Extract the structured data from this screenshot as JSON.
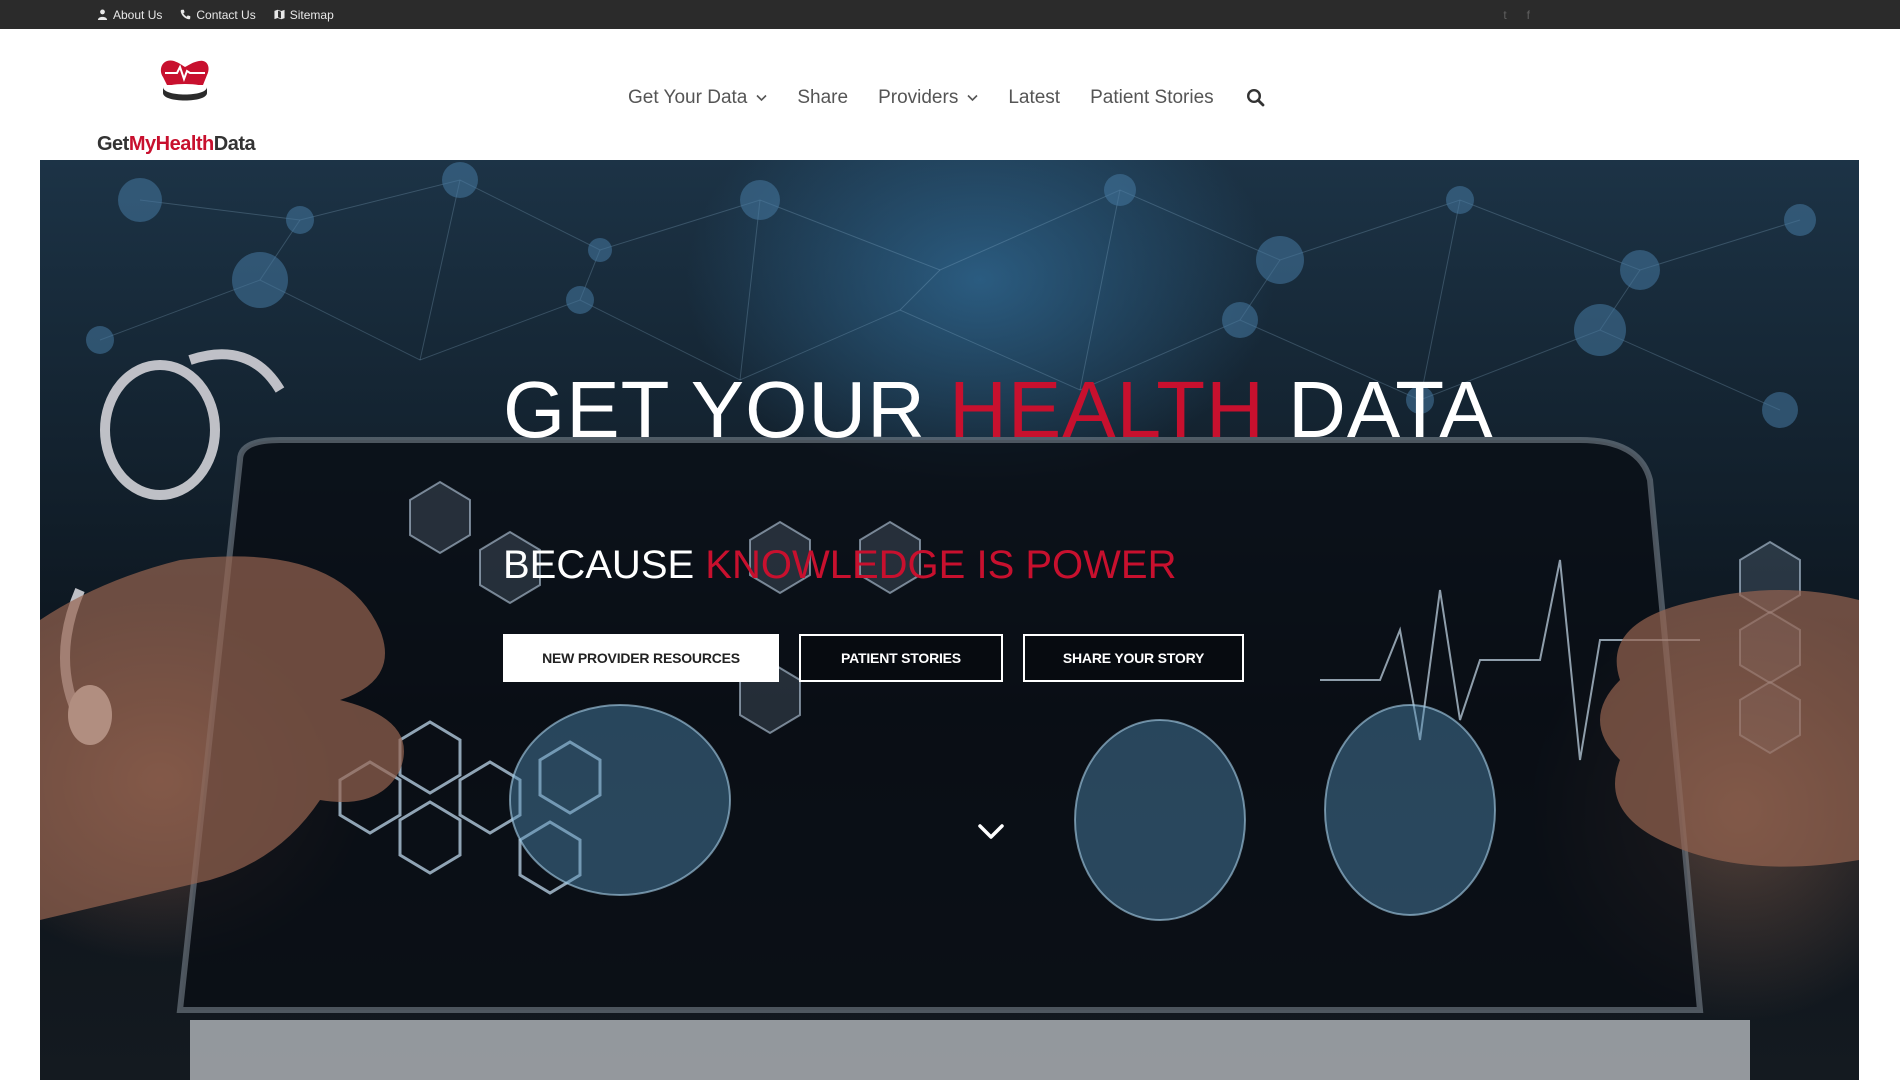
{
  "topbar": {
    "links": [
      {
        "label": "About Us",
        "icon": "user-icon"
      },
      {
        "label": "Contact Us",
        "icon": "phone-icon"
      },
      {
        "label": "Sitemap",
        "icon": "map-icon"
      }
    ],
    "social": [
      {
        "icon": "twitter-icon",
        "glyph": "t"
      },
      {
        "icon": "facebook-icon",
        "glyph": "f"
      }
    ]
  },
  "header": {
    "logo": {
      "text_dark_1": "Get",
      "text_red": "MyHealth",
      "text_dark_2": "Data"
    },
    "nav": [
      {
        "label": "Get Your Data",
        "has_dropdown": true
      },
      {
        "label": "Share",
        "has_dropdown": false
      },
      {
        "label": "Providers",
        "has_dropdown": true
      },
      {
        "label": "Latest",
        "has_dropdown": false
      },
      {
        "label": "Patient Stories",
        "has_dropdown": false
      }
    ]
  },
  "hero": {
    "title_part1": "GET YOUR ",
    "title_part2": "HEALTH",
    "title_part3": " DATA",
    "subtitle_part1": "BECAUSE ",
    "subtitle_part2": "KNOWLEDGE IS POWER",
    "buttons": [
      {
        "label": "NEW PROVIDER RESOURCES",
        "style": "solid"
      },
      {
        "label": "PATIENT STORIES",
        "style": "outline"
      },
      {
        "label": "SHARE YOUR STORY",
        "style": "outline"
      }
    ]
  },
  "colors": {
    "accent": "#c8102e",
    "topbar_bg": "#2b2b2b",
    "nav_text": "#555555"
  }
}
